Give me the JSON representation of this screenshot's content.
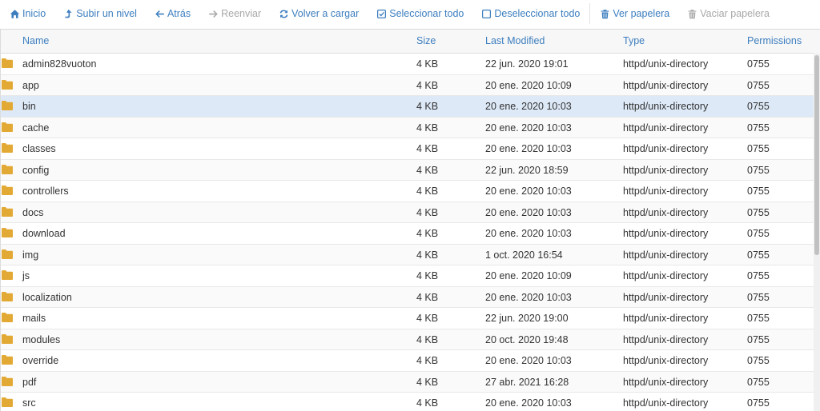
{
  "toolbar": {
    "home": "Inicio",
    "up": "Subir un nivel",
    "back": "Atrás",
    "forward": "Reenviar",
    "reload": "Volver a cargar",
    "select_all": "Seleccionar todo",
    "deselect_all": "Deseleccionar todo",
    "view_trash": "Ver papelera",
    "empty_trash": "Vaciar papelera"
  },
  "columns": {
    "name": "Name",
    "size": "Size",
    "modified": "Last Modified",
    "type": "Type",
    "permissions": "Permissions"
  },
  "colors": {
    "accent": "#3d7ebf",
    "folder": "#e3a935",
    "selected_row": "#dde9f7"
  },
  "selected_index": 2,
  "files": [
    {
      "name": "admin828vuoton",
      "size": "4 KB",
      "modified": "22 jun. 2020 19:01",
      "type": "httpd/unix-directory",
      "perm": "0755"
    },
    {
      "name": "app",
      "size": "4 KB",
      "modified": "20 ene. 2020 10:09",
      "type": "httpd/unix-directory",
      "perm": "0755"
    },
    {
      "name": "bin",
      "size": "4 KB",
      "modified": "20 ene. 2020 10:03",
      "type": "httpd/unix-directory",
      "perm": "0755"
    },
    {
      "name": "cache",
      "size": "4 KB",
      "modified": "20 ene. 2020 10:03",
      "type": "httpd/unix-directory",
      "perm": "0755"
    },
    {
      "name": "classes",
      "size": "4 KB",
      "modified": "20 ene. 2020 10:03",
      "type": "httpd/unix-directory",
      "perm": "0755"
    },
    {
      "name": "config",
      "size": "4 KB",
      "modified": "22 jun. 2020 18:59",
      "type": "httpd/unix-directory",
      "perm": "0755"
    },
    {
      "name": "controllers",
      "size": "4 KB",
      "modified": "20 ene. 2020 10:03",
      "type": "httpd/unix-directory",
      "perm": "0755"
    },
    {
      "name": "docs",
      "size": "4 KB",
      "modified": "20 ene. 2020 10:03",
      "type": "httpd/unix-directory",
      "perm": "0755"
    },
    {
      "name": "download",
      "size": "4 KB",
      "modified": "20 ene. 2020 10:03",
      "type": "httpd/unix-directory",
      "perm": "0755"
    },
    {
      "name": "img",
      "size": "4 KB",
      "modified": "1 oct. 2020 16:54",
      "type": "httpd/unix-directory",
      "perm": "0755"
    },
    {
      "name": "js",
      "size": "4 KB",
      "modified": "20 ene. 2020 10:09",
      "type": "httpd/unix-directory",
      "perm": "0755"
    },
    {
      "name": "localization",
      "size": "4 KB",
      "modified": "20 ene. 2020 10:03",
      "type": "httpd/unix-directory",
      "perm": "0755"
    },
    {
      "name": "mails",
      "size": "4 KB",
      "modified": "22 jun. 2020 19:00",
      "type": "httpd/unix-directory",
      "perm": "0755"
    },
    {
      "name": "modules",
      "size": "4 KB",
      "modified": "20 oct. 2020 19:48",
      "type": "httpd/unix-directory",
      "perm": "0755"
    },
    {
      "name": "override",
      "size": "4 KB",
      "modified": "20 ene. 2020 10:03",
      "type": "httpd/unix-directory",
      "perm": "0755"
    },
    {
      "name": "pdf",
      "size": "4 KB",
      "modified": "27 abr. 2021 16:28",
      "type": "httpd/unix-directory",
      "perm": "0755"
    },
    {
      "name": "src",
      "size": "4 KB",
      "modified": "20 ene. 2020 10:03",
      "type": "httpd/unix-directory",
      "perm": "0755"
    }
  ]
}
